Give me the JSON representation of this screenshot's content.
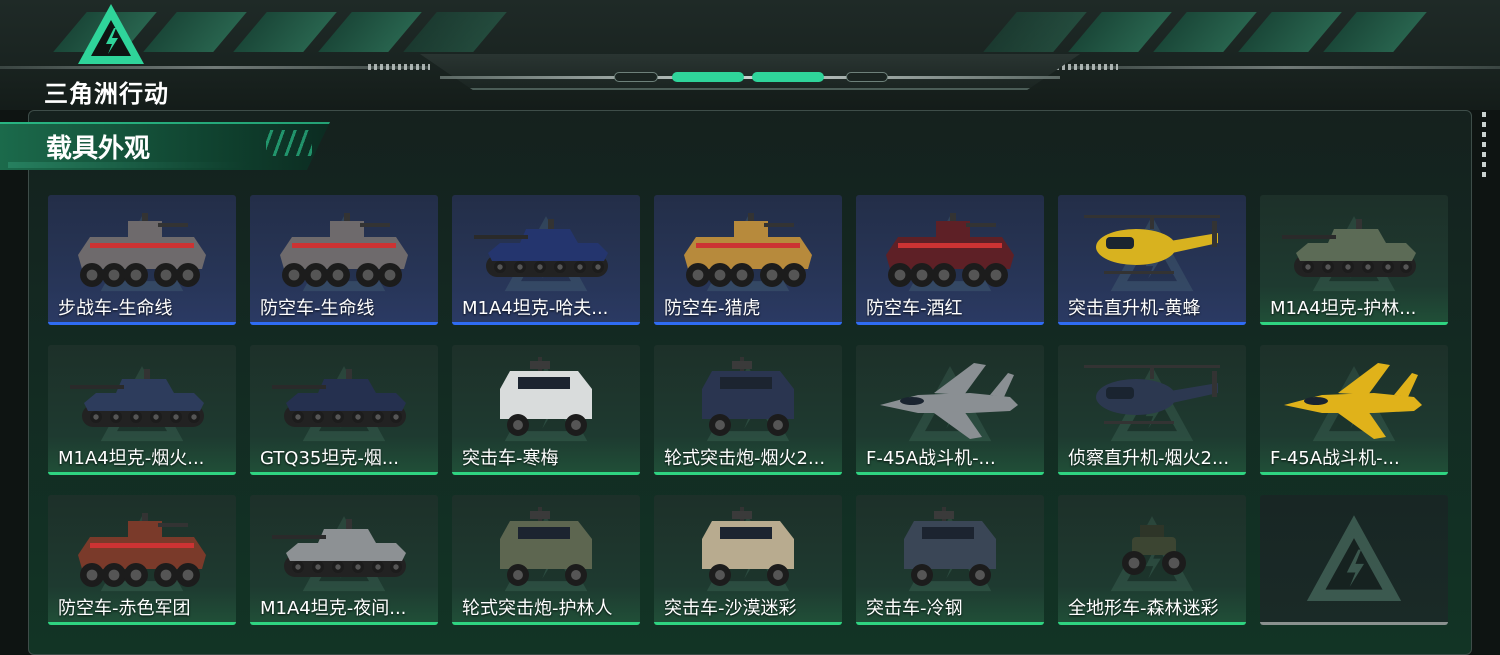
{
  "brand": {
    "name": "三角洲行动",
    "accent": "#2fd49a"
  },
  "section": {
    "title": "载具外观"
  },
  "colors": {
    "blue_rarity": "#2f6cf4",
    "green_rarity": "#2fd481",
    "empty_slot": "#8a918f"
  },
  "items": [
    {
      "label": "步战车-生命线",
      "rarity": "blue",
      "icon": "apc-icon",
      "paint": "#6e6a6c"
    },
    {
      "label": "防空车-生命线",
      "rarity": "blue",
      "icon": "apc-icon",
      "paint": "#6e6a6c"
    },
    {
      "label": "M1A4坦克-哈夫...",
      "rarity": "blue",
      "icon": "tank-icon",
      "paint": "#24356e"
    },
    {
      "label": "防空车-猎虎",
      "rarity": "blue",
      "icon": "apc-icon",
      "paint": "#b78a3c"
    },
    {
      "label": "防空车-酒红",
      "rarity": "blue",
      "icon": "apc-icon",
      "paint": "#5e2026"
    },
    {
      "label": "突击直升机-黄蜂",
      "rarity": "blue",
      "icon": "helicopter-icon",
      "paint": "#d8b21f"
    },
    {
      "label": "M1A4坦克-护林...",
      "rarity": "green",
      "icon": "tank-icon",
      "paint": "#5c6b56"
    },
    {
      "label": "M1A4坦克-烟火...",
      "rarity": "green",
      "icon": "tank-icon",
      "paint": "#2d3c5c"
    },
    {
      "label": "GTQ35坦克-烟...",
      "rarity": "green",
      "icon": "tank-icon",
      "paint": "#25304f"
    },
    {
      "label": "突击车-寒梅",
      "rarity": "green",
      "icon": "armored-car-icon",
      "paint": "#d9dcdc"
    },
    {
      "label": "轮式突击炮-烟火2...",
      "rarity": "green",
      "icon": "armored-car-icon",
      "paint": "#2a3550"
    },
    {
      "label": "F-45A战斗机-...",
      "rarity": "green",
      "icon": "jet-icon",
      "paint": "#8a8f93"
    },
    {
      "label": "侦察直升机-烟火2...",
      "rarity": "green",
      "icon": "helicopter-icon",
      "paint": "#2c3850"
    },
    {
      "label": "F-45A战斗机-...",
      "rarity": "green",
      "icon": "jet-icon",
      "paint": "#e0b21a"
    },
    {
      "label": "防空车-赤色军团",
      "rarity": "green",
      "icon": "apc-icon",
      "paint": "#7a3a2a"
    },
    {
      "label": "M1A4坦克-夜间...",
      "rarity": "green",
      "icon": "tank-icon",
      "paint": "#8d9194"
    },
    {
      "label": "轮式突击炮-护林人",
      "rarity": "green",
      "icon": "armored-car-icon",
      "paint": "#5d6650"
    },
    {
      "label": "突击车-沙漠迷彩",
      "rarity": "green",
      "icon": "armored-car-icon",
      "paint": "#b8ab8f"
    },
    {
      "label": "突击车-冷钢",
      "rarity": "green",
      "icon": "armored-car-icon",
      "paint": "#3a4656"
    },
    {
      "label": "全地形车-森林迷彩",
      "rarity": "green",
      "icon": "atv-icon",
      "paint": "#3c4532"
    },
    {
      "label": "",
      "rarity": "empty",
      "icon": "empty-slot-icon",
      "paint": ""
    }
  ]
}
